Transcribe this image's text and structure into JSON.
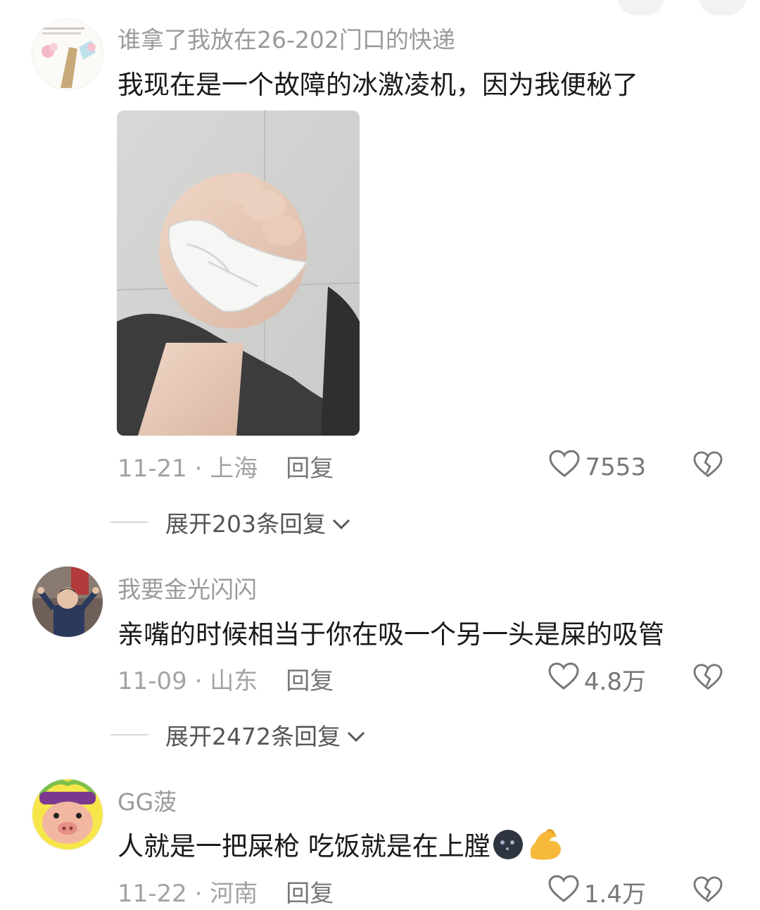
{
  "comments": [
    {
      "username": "谁拿了我放在26-202门口的快递",
      "text": "我现在是一个故障的冰激凌机，因为我便秘了",
      "date_location": "11-21 · 上海",
      "reply_label": "回复",
      "likes": "7553",
      "expand_label": "展开203条回复"
    },
    {
      "username": "我要金光闪闪",
      "text": "亲嘴的时候相当于你在吸一个另一头是屎的吸管",
      "date_location": "11-09 · 山东",
      "reply_label": "回复",
      "likes": "4.8万",
      "expand_label": "展开2472条回复"
    },
    {
      "username": "GG菠",
      "text": "人就是一把屎枪 吃饭就是在上膛",
      "date_location": "11-22 · 河南",
      "reply_label": "回复",
      "likes": "1.4万"
    }
  ],
  "icons": {
    "like": "heart-outline-icon",
    "dislike": "broken-heart-icon",
    "expand": "chevron-down-icon",
    "emoji_1": "black-moon-face-emoji",
    "emoji_2": "flexed-biceps-emoji"
  },
  "colors": {
    "username": "#9a9a9a",
    "body_text": "#1a1a1a",
    "meta": "#a3a3a3"
  }
}
